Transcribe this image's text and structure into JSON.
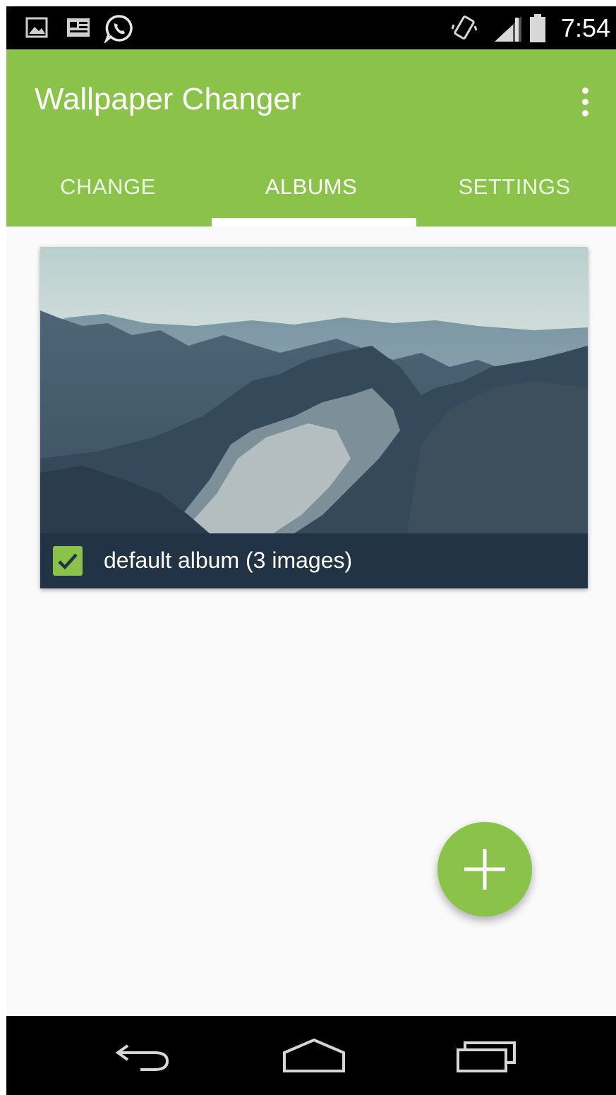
{
  "status_bar": {
    "time": "7:54",
    "left_icons": [
      "image-notification-icon",
      "news-notification-icon",
      "whatsapp-icon"
    ],
    "right_icons": [
      "vibrate-icon",
      "signal-icon",
      "battery-icon"
    ]
  },
  "app_bar": {
    "title": "Wallpaper Changer",
    "menu_icon": "overflow-menu-icon"
  },
  "tabs": [
    {
      "label": "CHANGE",
      "active": false
    },
    {
      "label": "ALBUMS",
      "active": true
    },
    {
      "label": "SETTINGS",
      "active": false
    }
  ],
  "albums": [
    {
      "label": "default album (3 images)",
      "checked": true
    }
  ],
  "fab": {
    "icon": "plus-icon"
  },
  "nav_bar": {
    "icons": [
      "back-icon",
      "home-icon",
      "recents-icon"
    ]
  },
  "colors": {
    "primary": "#8bc34a",
    "status_bar": "#000000",
    "card_footer": "#223346",
    "background": "#fafafa"
  }
}
